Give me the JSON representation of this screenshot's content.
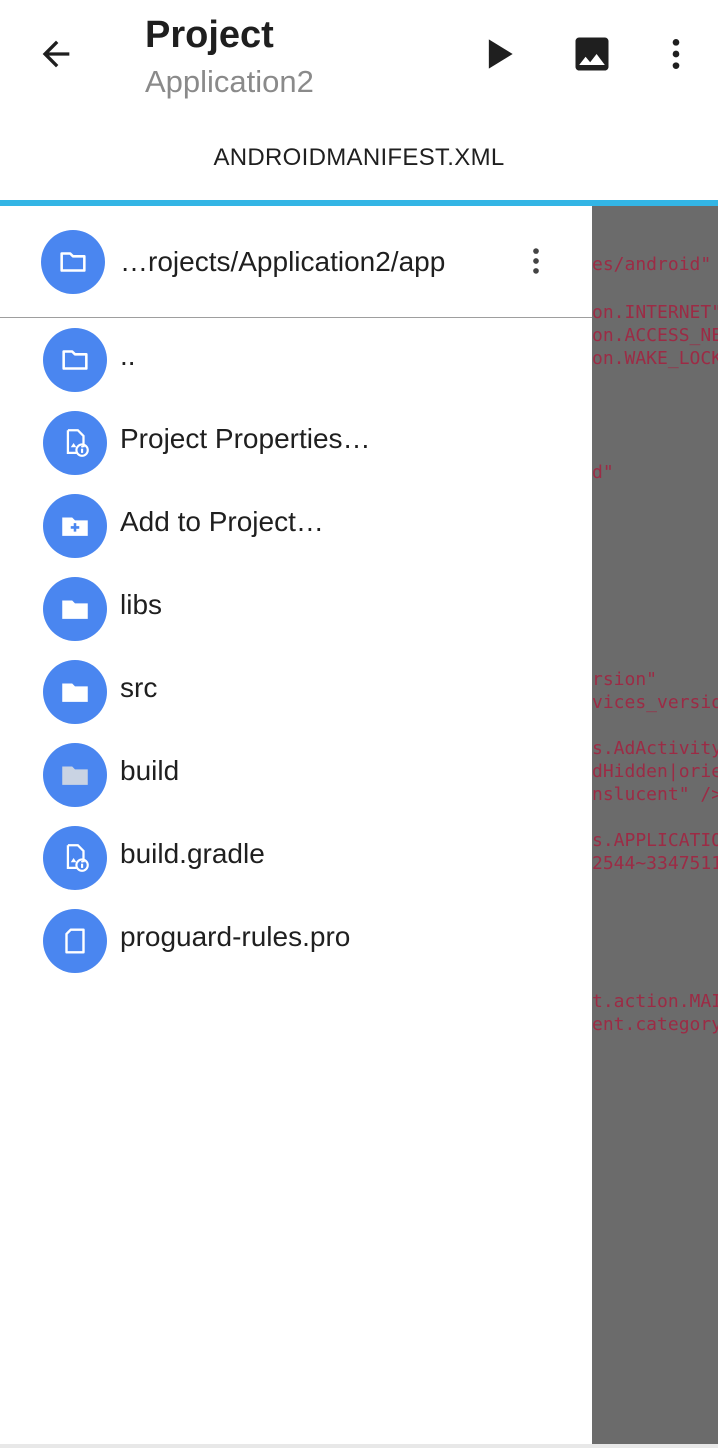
{
  "appbar": {
    "title": "Project",
    "subtitle": "Application2",
    "back_icon": "arrow-left-icon",
    "actions": [
      "play-icon",
      "image-icon",
      "more-vert-icon"
    ]
  },
  "tab": {
    "label": "ANDROIDMANIFEST.XML"
  },
  "accent_color": "#33b5e5",
  "folder_circle_color": "#4a86f0",
  "drawer": {
    "path": "…rojects/Application2/app",
    "items": [
      {
        "label": "..",
        "icon": "folder-outline-icon"
      },
      {
        "label": "Project Properties…",
        "icon": "file-info-icon"
      },
      {
        "label": "Add to Project…",
        "icon": "folder-add-icon"
      },
      {
        "label": "libs",
        "icon": "folder-icon"
      },
      {
        "label": "src",
        "icon": "folder-icon"
      },
      {
        "label": "build",
        "icon": "folder-grey-icon"
      },
      {
        "label": "build.gradle",
        "icon": "file-info-icon"
      },
      {
        "label": "proguard-rules.pro",
        "icon": "file-icon"
      }
    ]
  },
  "editor": {
    "lines": [
      "es/android\"",
      "on.INTERNET\"",
      "on.ACCESS_NE",
      "on.WAKE_LOCK",
      "d\"",
      "rsion\"",
      "vices_versio",
      "s.AdActivity",
      "dHidden|orie",
      "nslucent\" />",
      "s.APPLICATIO",
      "2544~3347511",
      "t.action.MAI",
      "ent.category"
    ]
  }
}
